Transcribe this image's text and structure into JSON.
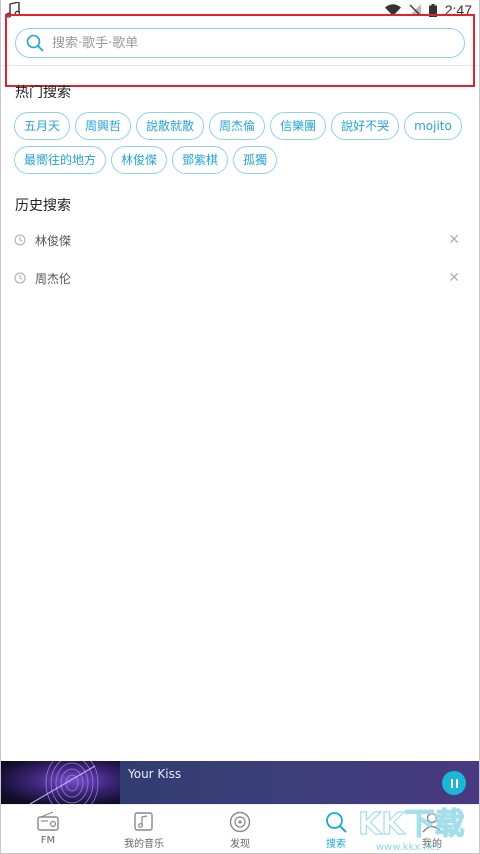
{
  "status_bar": {
    "time": "2:47"
  },
  "search": {
    "placeholder": "搜索·歌手·歌单",
    "value": ""
  },
  "hot": {
    "title": "热门搜索",
    "tags": [
      "五月天",
      "周興哲",
      "說散就散",
      "周杰倫",
      "信樂團",
      "說好不哭",
      "mojito",
      "最嚮往的地方",
      "林俊傑",
      "鄧紫棋",
      "孤獨"
    ]
  },
  "history": {
    "title": "历史搜索",
    "items": [
      "林俊傑",
      "周杰伦"
    ]
  },
  "player": {
    "song": "Your Kiss"
  },
  "nav": {
    "items": [
      {
        "label": "FM",
        "icon": "radio-icon"
      },
      {
        "label": "我的音乐",
        "icon": "music-library-icon"
      },
      {
        "label": "发现",
        "icon": "disc-icon"
      },
      {
        "label": "搜索",
        "icon": "search-icon"
      },
      {
        "label": "我的",
        "icon": "person-icon"
      }
    ],
    "active": "搜索"
  },
  "watermark": {
    "text": "KK下载",
    "url": "www.kkx.net"
  },
  "colors": {
    "accent": "#1ba9d6",
    "tag_border": "#8fd2ea",
    "highlight": "#e0242c"
  }
}
